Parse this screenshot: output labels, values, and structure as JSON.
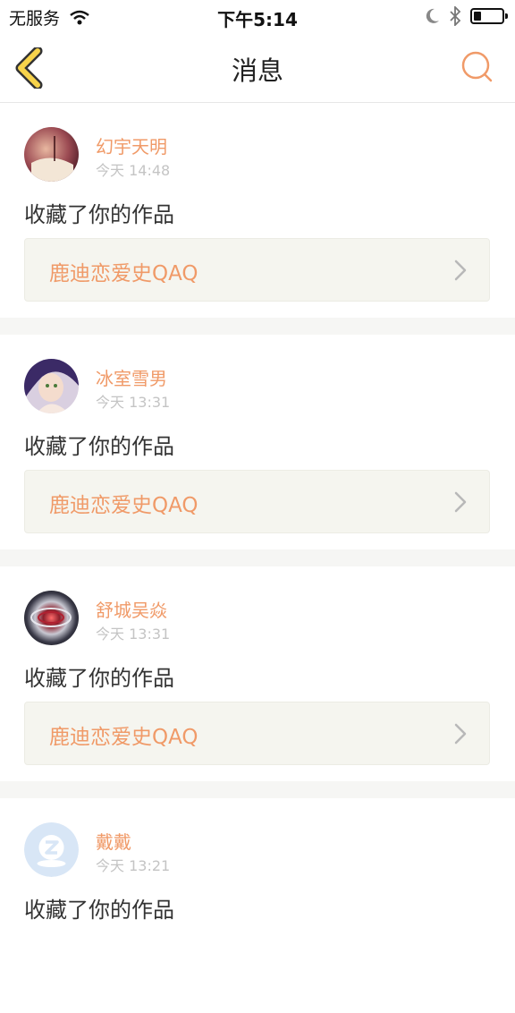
{
  "status_bar": {
    "carrier": "无服务",
    "time": "下午5:14",
    "icons": [
      "wifi-icon",
      "moon-icon",
      "bluetooth-icon",
      "battery-icon"
    ]
  },
  "nav": {
    "title": "消息",
    "back_icon": "chevron-left-icon",
    "search_icon": "search-icon",
    "accent_color": "#f09a68",
    "back_color": "#f7d34b"
  },
  "messages": [
    {
      "user": "幻宇天明",
      "time": "今天 14:48",
      "action": "收藏了你的作品",
      "work": "鹿迪恋爱史QAQ"
    },
    {
      "user": "冰室雪男",
      "time": "今天 13:31",
      "action": "收藏了你的作品",
      "work": "鹿迪恋爱史QAQ"
    },
    {
      "user": "舒城吴焱",
      "time": "今天 13:31",
      "action": "收藏了你的作品",
      "work": "鹿迪恋爱史QAQ"
    },
    {
      "user": "戴戴",
      "time": "今天 13:21",
      "action": "收藏了你的作品",
      "work": ""
    }
  ]
}
